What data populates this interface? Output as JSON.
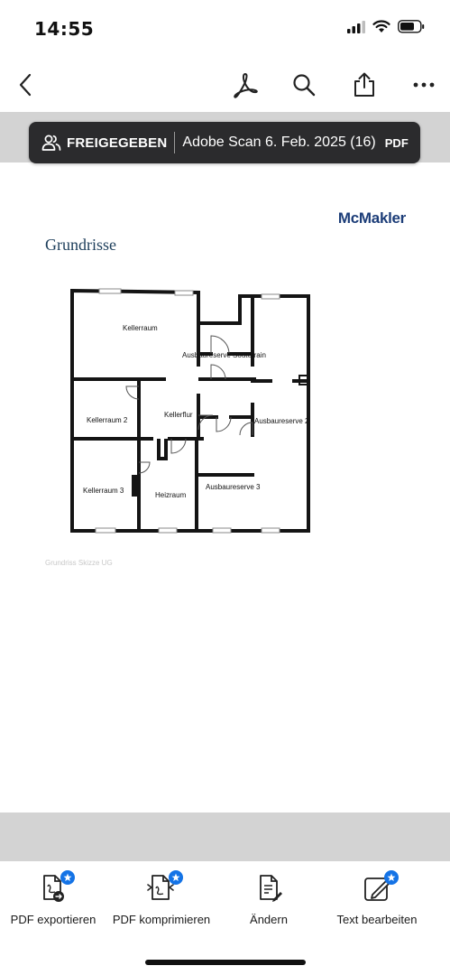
{
  "status_bar": {
    "time": "14:55"
  },
  "nav": {
    "back_icon": "chevron-left-icon",
    "acrobat_icon": "acrobat-icon",
    "search_icon": "search-icon",
    "share_icon": "share-icon",
    "more_icon": "more-icon"
  },
  "shared_banner": {
    "label": "FREIGEGEBEN",
    "document_name": "Adobe Scan 6. Feb. 2025 (16)",
    "file_type": "PDF"
  },
  "document": {
    "brand": "McMakler",
    "title": "Grundrisse",
    "rooms": {
      "kellerraum": "Kellerraum",
      "ausbaureserve_souterrain": "Ausbaureserve Souterrain",
      "kellerraum_2": "Kellerraum 2",
      "kellerflur": "Kellerflur",
      "ausbaureserve_2": "Ausbaureserve 2",
      "kellerraum_3": "Kellerraum 3",
      "heizraum": "Heizraum",
      "ausbaureserve_3": "Ausbaureserve 3"
    },
    "caption": "Grundriss Skizze UG"
  },
  "toolbar": {
    "export": "PDF exportieren",
    "compress": "PDF komprimieren",
    "edit": "Ändern",
    "edit_text": "Text bearbeiten"
  },
  "colors": {
    "accent": "#1473e6",
    "banner": "#2b2b2d",
    "brand": "#1c3d78",
    "viewer_bg": "#d3d3d3"
  }
}
